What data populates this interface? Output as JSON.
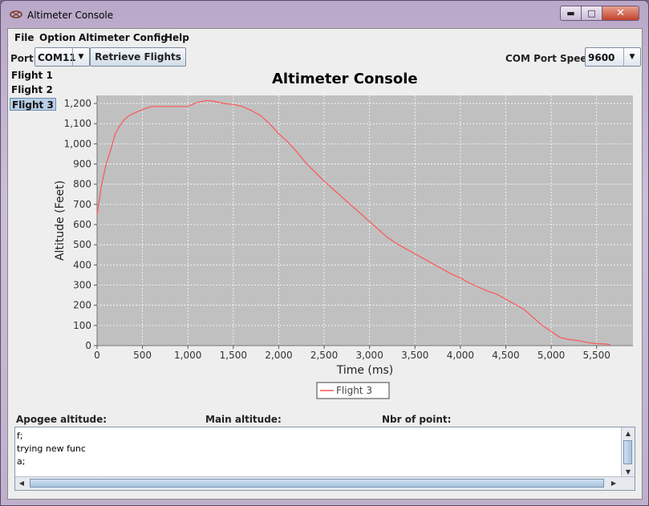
{
  "window": {
    "title": "Altimeter Console"
  },
  "menu": [
    "File",
    "Option",
    "Altimeter Config",
    "Help"
  ],
  "toolbar": {
    "port_label": "Port:",
    "port_value": "COM11",
    "retrieve_label": "Retrieve Flights",
    "speed_label": "COM Port Speed:",
    "speed_value": "9600"
  },
  "flights": [
    "Flight 1",
    "Flight 2",
    "Flight 3"
  ],
  "selected_flight": "Flight 3",
  "info": {
    "apogee_label": "Apogee altitude:",
    "main_label": "Main altitude:",
    "points_label": "Nbr of point:"
  },
  "log_lines": [
    "f;",
    "trying new func",
    "a;"
  ],
  "chart_data": {
    "type": "line",
    "title": "Altimeter Console",
    "xlabel": "Time (ms)",
    "ylabel": "Altitude  (Feet)",
    "xlim": [
      0,
      5900
    ],
    "ylim": [
      0,
      1240
    ],
    "x_ticks": [
      0,
      500,
      1000,
      1500,
      2000,
      2500,
      3000,
      3500,
      4000,
      4500,
      5000,
      5500
    ],
    "y_ticks": [
      0,
      100,
      200,
      300,
      400,
      500,
      600,
      700,
      800,
      900,
      1000,
      1100,
      1200
    ],
    "x_tick_labels": [
      "0",
      "500",
      "1,000",
      "1,500",
      "2,000",
      "2,500",
      "3,000",
      "3,500",
      "4,000",
      "4,500",
      "5,000",
      "5,500"
    ],
    "y_tick_labels": [
      "0",
      "100",
      "200",
      "300",
      "400",
      "500",
      "600",
      "700",
      "800",
      "900",
      "1,000",
      "1,100",
      "1,200"
    ],
    "grid": true,
    "legend": "bottom-center",
    "series": [
      {
        "name": "Flight 3",
        "color": "#ff5555",
        "x": [
          0,
          50,
          100,
          150,
          200,
          250,
          300,
          350,
          400,
          500,
          600,
          700,
          800,
          900,
          1000,
          1100,
          1200,
          1300,
          1400,
          1500,
          1600,
          1700,
          1800,
          1900,
          2000,
          2100,
          2200,
          2300,
          2400,
          2500,
          2600,
          2700,
          2800,
          2900,
          3000,
          3100,
          3200,
          3300,
          3400,
          3500,
          3600,
          3700,
          3800,
          3900,
          4000,
          4100,
          4200,
          4300,
          4400,
          4500,
          4600,
          4700,
          4800,
          4900,
          5000,
          5100,
          5200,
          5300,
          5400,
          5500,
          5600,
          5650
        ],
        "y": [
          650,
          800,
          900,
          970,
          1050,
          1090,
          1120,
          1140,
          1150,
          1170,
          1185,
          1185,
          1185,
          1185,
          1185,
          1205,
          1215,
          1210,
          1200,
          1195,
          1185,
          1165,
          1140,
          1100,
          1050,
          1010,
          960,
          905,
          860,
          815,
          775,
          735,
          695,
          655,
          615,
          575,
          535,
          505,
          480,
          455,
          430,
          405,
          380,
          355,
          335,
          310,
          290,
          270,
          255,
          230,
          205,
          180,
          140,
          100,
          70,
          40,
          30,
          25,
          15,
          10,
          8,
          5
        ]
      }
    ]
  }
}
